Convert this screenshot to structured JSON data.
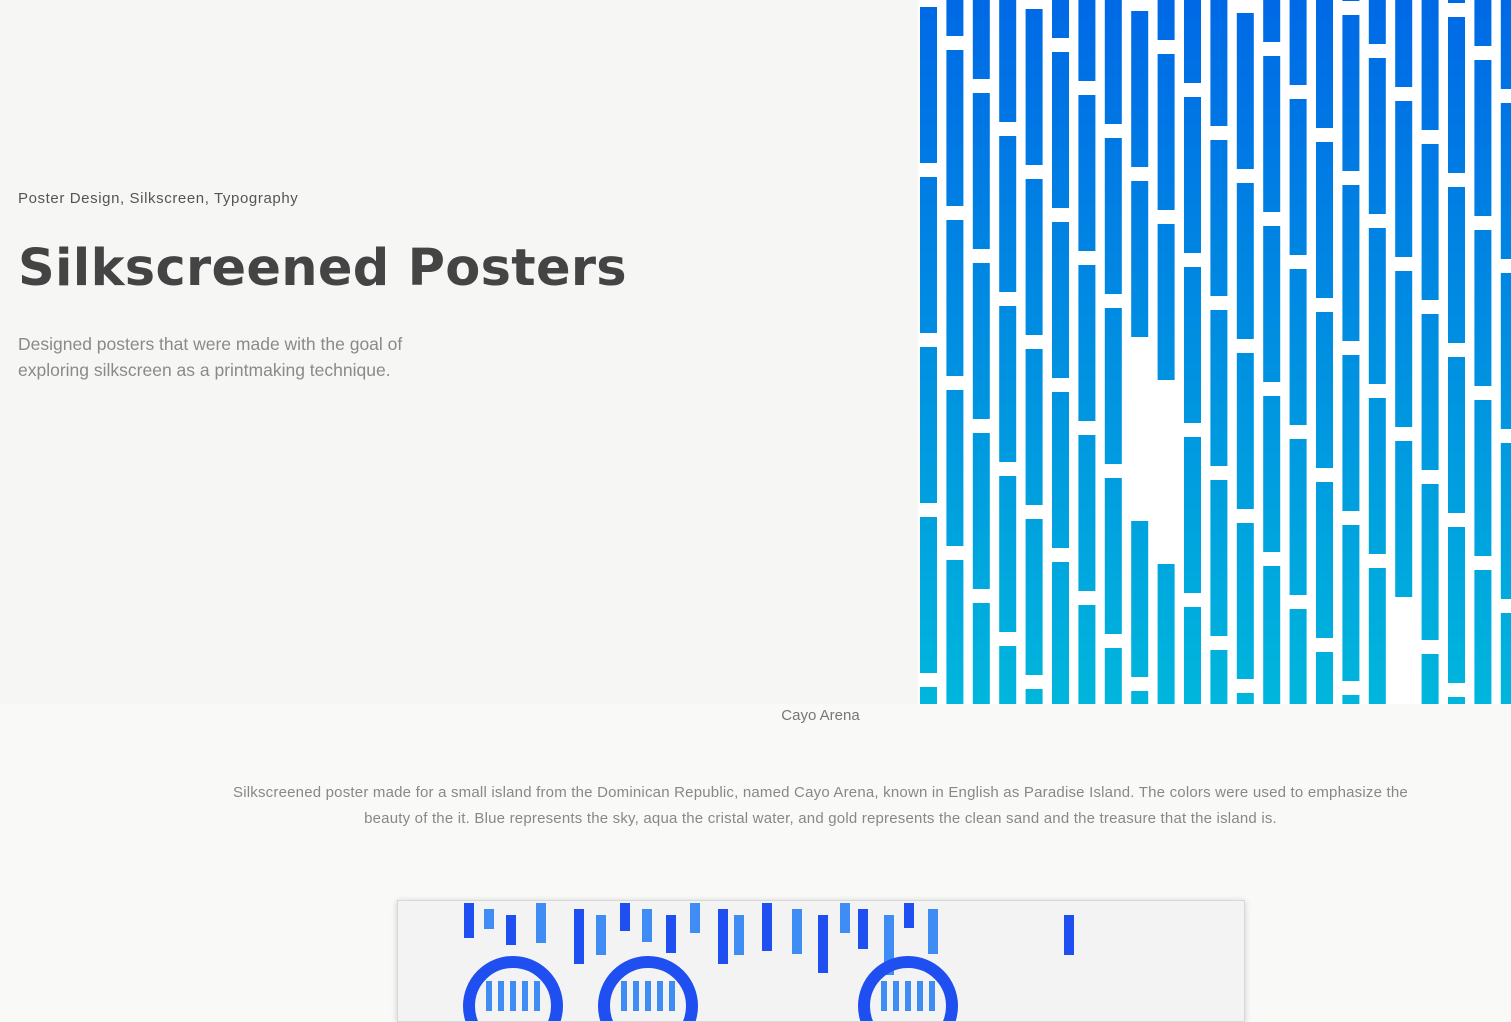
{
  "hero": {
    "tags": "Poster Design, Silkscreen, Typography",
    "title": "Silkscreened Posters",
    "subtitle": "Designed posters that were made with the goal of exploring silkscreen as a printmaking technique."
  },
  "project": {
    "caption": "Cayo Arena",
    "description": "Silkscreened poster made for a small island from the Dominican Republic, named Cayo Arena, known in English as Paradise Island. The colors were used to emphasize the beauty of the it. Blue represents the sky, aqua the cristal water, and gold represents the clean sand and the treasure that the island is."
  },
  "colors": {
    "pattern_top": "#0069e6",
    "pattern_bottom": "#00b6dc",
    "preview_blue": "#1f4ff0",
    "preview_light": "#3f8cf5"
  }
}
